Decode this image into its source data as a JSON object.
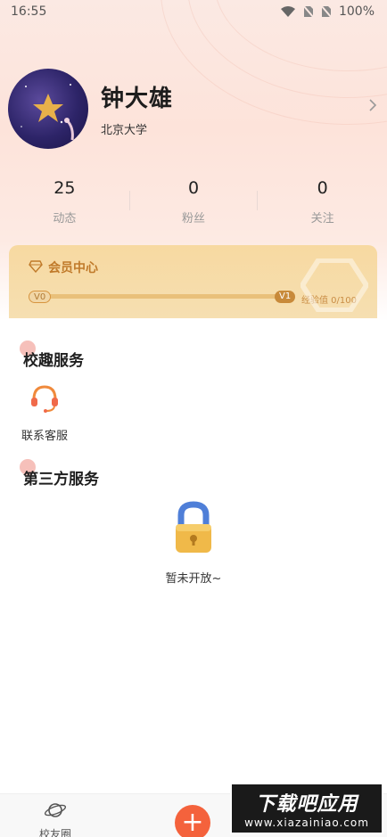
{
  "status_bar": {
    "time": "16:55",
    "battery": "100%"
  },
  "profile": {
    "name": "钟大雄",
    "school": "北京大学"
  },
  "stats": [
    {
      "value": "25",
      "label": "动态"
    },
    {
      "value": "0",
      "label": "粉丝"
    },
    {
      "value": "0",
      "label": "关注"
    }
  ],
  "member": {
    "title": "会员中心",
    "level_start": "V0",
    "level_end": "V1",
    "exp_text": "经验值 0/100",
    "progress": 0.0
  },
  "sections": {
    "campus_title": "校趣服务",
    "third_party_title": "第三方服务"
  },
  "services": [
    {
      "label": "联系客服",
      "icon": "headset-icon"
    }
  ],
  "third_party": {
    "empty_text": "暂未开放~",
    "icon": "lock-icon"
  },
  "tab_bar": {
    "tabs": [
      {
        "label": "校友圈",
        "icon": "planet-icon"
      }
    ],
    "fab_icon": "plus-icon"
  },
  "watermark": {
    "title": "下载吧应用",
    "url": "www.xiazainiao.com"
  },
  "colors": {
    "accent": "#f4623c",
    "member_gold": "#c07a2a",
    "header_bg": "#fde3da"
  }
}
